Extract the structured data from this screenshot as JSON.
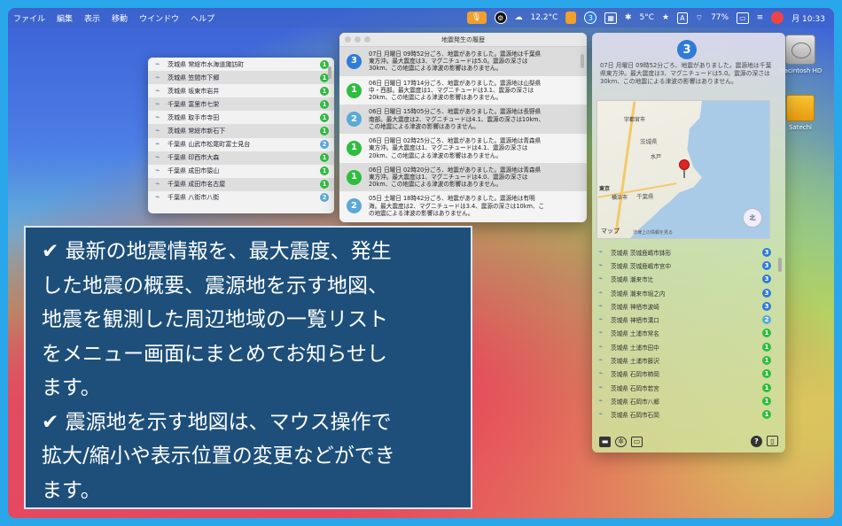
{
  "menubar": {
    "items": [
      "ファイル",
      "編集",
      "表示",
      "移動",
      "ウインドウ",
      "ヘルプ"
    ],
    "weather": "12.2°C",
    "badge_count": "3",
    "temp2": "5°C",
    "input_mode": "A",
    "battery": "77%",
    "clock": "月 10:33"
  },
  "list_window": {
    "rows": [
      {
        "place": "茨城県 常総市水海道諏訪町",
        "level": "1"
      },
      {
        "place": "茨城県 笠間市下郷",
        "level": "1"
      },
      {
        "place": "茨城県 坂東市岩井",
        "level": "1"
      },
      {
        "place": "千葉県 富里市七栄",
        "level": "1"
      },
      {
        "place": "茨城県 取手市寺田",
        "level": "1"
      },
      {
        "place": "茨城県 常総市新石下",
        "level": "1"
      },
      {
        "place": "千葉県 山武市松尾町富士見台",
        "level": "2"
      },
      {
        "place": "千葉県 印西市大森",
        "level": "1"
      },
      {
        "place": "千葉県 成田市猿山",
        "level": "1"
      },
      {
        "place": "千葉県 成田市名古屋",
        "level": "1"
      },
      {
        "place": "千葉県 八街市八街",
        "level": "2"
      }
    ]
  },
  "history_window": {
    "title": "地震発生の履歴",
    "items": [
      {
        "level": "3",
        "text": "07日 月曜日 09時52分ごろ、地震がありました。震源地は千葉県\n東方沖。最大震度は3、マグニチュードは5.0。震源の深さは\n30km、この地震による津波の影響はありません。"
      },
      {
        "level": "1",
        "text": "06日 日曜日 17時14分ごろ、地震がありました。震源地は山梨県\n中・西部。最大震度は1、マグニチュードは3.1、震源の深さは\n20km、この地震による津波の影響はありません。"
      },
      {
        "level": "2",
        "text": "06日 日曜日 15時05分ごろ、地震がありました。震源地は長野県\n南部。最大震度は2、マグニチュードは4.1、震源の深さは10km、\nこの地震による津波の影響はありません。"
      },
      {
        "level": "1",
        "text": "06日 日曜日 02時25分ごろ、地震がありました。震源地は青森県\n東方沖。最大震度は1、マグニチュードは4.1、震源の深さは\n20km、この地震による津波の影響はありません。"
      },
      {
        "level": "1",
        "text": "06日 日曜日 02時20分ごろ、地震がありました。震源地は青森県\n東方沖。最大震度は1、マグニチュードは4.0、震源の深さは\n20km、この地震による津波の影響はありません。"
      },
      {
        "level": "2",
        "text": "05日 土曜日 18時42分ごろ、地震がありました。震源地は有明\n海。最大震度は2、マグニチュードは3.4、震源の深さは10km、こ\nの地震による津波の影響はありません。"
      }
    ]
  },
  "panel": {
    "level": "3",
    "summary": "07日 月曜日 09時52分ごろ、地震がありました。震源地は千葉県東方沖。最大震度は3、マグニチュードは5.0。震源の深さは30km、この地震による津波の影響はありません。",
    "map": {
      "pref_ibaraki": "茨城県",
      "pref_chiba": "千葉県",
      "city_utsunomiya": "宇都宮市",
      "city_mito": "水戸",
      "city_tokyo": "東京",
      "city_yokohama": "横浜市",
      "city_chiba": "千葉県",
      "compass": "北",
      "logo": "マップ",
      "legal": "法律上の情報を見る"
    },
    "places": [
      {
        "place": "茨城県 茨城鹿嶋市鉢形",
        "level": "3"
      },
      {
        "place": "茨城県 茨城鹿嶋市宮中",
        "level": "3"
      },
      {
        "place": "茨城県 潮来市辻",
        "level": "3"
      },
      {
        "place": "茨城県 潮来市堀之内",
        "level": "3"
      },
      {
        "place": "茨城県 神栖市波崎",
        "level": "3"
      },
      {
        "place": "茨城県 神栖市溝口",
        "level": "2"
      },
      {
        "place": "茨城県 土浦市常名",
        "level": "1"
      },
      {
        "place": "茨城県 土浦市田中",
        "level": "1"
      },
      {
        "place": "茨城県 土浦市藤沢",
        "level": "1"
      },
      {
        "place": "茨城県 石岡市柿岡",
        "level": "1"
      },
      {
        "place": "茨城県 石岡市若宮",
        "level": "1"
      },
      {
        "place": "茨城県 石岡市八郷",
        "level": "1"
      },
      {
        "place": "茨城県 石岡市石岡",
        "level": "1"
      }
    ]
  },
  "desktop": {
    "hdd_label": "Macintosh HD",
    "drive_label": "Satechi"
  },
  "caption": {
    "line1": "✔ 最新の地震情報を、最大震度、発生",
    "line2": "した地震の概要、震源地を示す地図、",
    "line3": "地震を観測した周辺地域の一覧リスト",
    "line4": "をメニュー画面にまとめてお知らせし",
    "line5": "ます。",
    "line6": "✔ 震源地を示す地図は、マウス操作で",
    "line7": "拡大/縮小や表示位置の変更などができ",
    "line8": "ます。"
  },
  "colors": {
    "level1": "#2ebd3e",
    "level2": "#5aa9d8",
    "level3": "#2f7bd8",
    "caption_bg": "#1d4f7a"
  }
}
